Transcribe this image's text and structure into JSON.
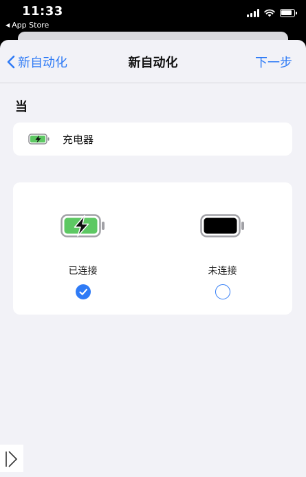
{
  "status_bar": {
    "time": "11:33",
    "back_app": "App Store",
    "back_arrow_icon": "left-triangle-icon",
    "icons": [
      "cellular-signal-icon",
      "wifi-icon",
      "battery-icon"
    ]
  },
  "nav": {
    "back_label": "新自动化",
    "title": "新自动化",
    "next_label": "下一步"
  },
  "section_label": "当",
  "trigger": {
    "icon": "battery-charging-icon",
    "label": "充电器"
  },
  "options": [
    {
      "icon": "battery-charging-icon",
      "label": "已连接",
      "selected": true
    },
    {
      "icon": "battery-full-icon",
      "label": "未连接",
      "selected": false
    }
  ],
  "colors": {
    "accent": "#2f7bf6",
    "battery_green": "#5dc863",
    "background": "#f2f2f7"
  }
}
